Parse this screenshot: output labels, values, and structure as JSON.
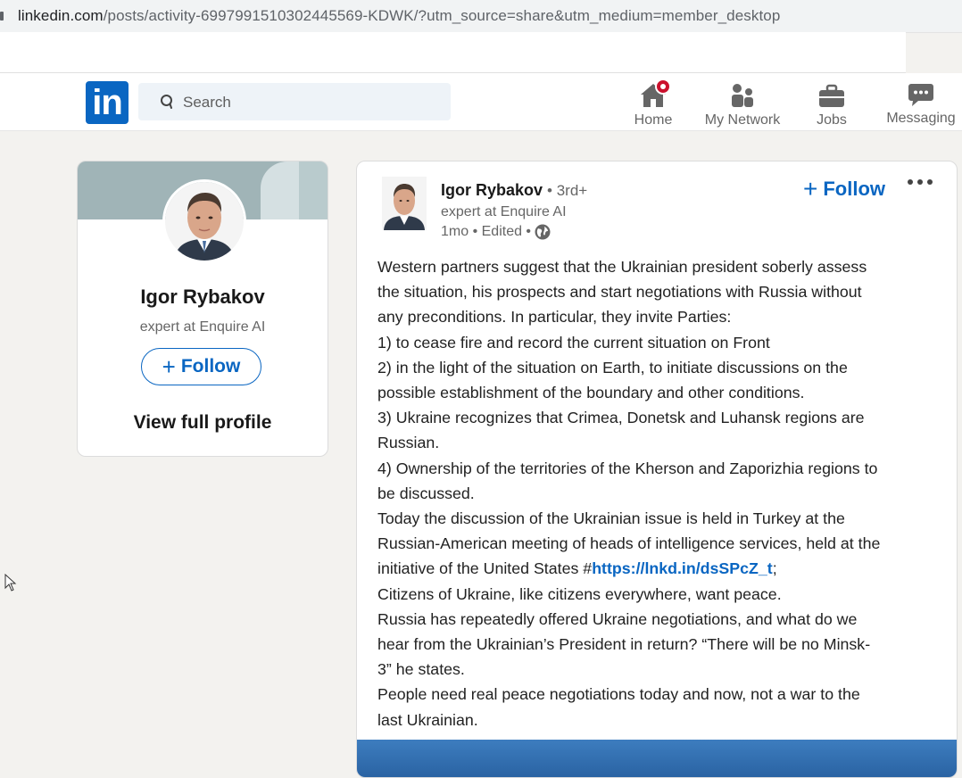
{
  "browser": {
    "url_host": "linkedin.com",
    "url_path": "/posts/activity-6997991510302445569-KDWK/?utm_source=share&utm_medium=member_desktop"
  },
  "header": {
    "logo_text": "in",
    "search_placeholder": "Search",
    "nav": [
      {
        "label": "Home",
        "icon": "home-icon",
        "badge": true
      },
      {
        "label": "My Network",
        "icon": "network-icon"
      },
      {
        "label": "Jobs",
        "icon": "briefcase-icon"
      },
      {
        "label": "Messaging",
        "icon": "chat-icon"
      }
    ],
    "brand_color": "#0a66c2",
    "badge_color": "#cb112d"
  },
  "profile_card": {
    "name": "Igor Rybakov",
    "headline": "expert at Enquire AI",
    "follow_label": "Follow",
    "view_profile_label": "View full profile"
  },
  "post": {
    "author_name": "Igor Rybakov",
    "degree": "• 3rd+",
    "headline": "expert at Enquire AI",
    "meta": "1mo • Edited •",
    "visibility_icon": "globe-icon",
    "follow_label": "Follow",
    "more_icon": "more-icon",
    "body_lines": [
      "Western partners suggest that the Ukrainian president soberly assess",
      "the situation, his prospects and start negotiations with Russia without",
      "any preconditions. In particular, they invite Parties:",
      "1) to cease fire and record the current situation on Front",
      "2) in the light of the situation on Earth, to initiate discussions on the",
      "possible establishment of the boundary and other conditions.",
      "3) Ukraine recognizes that Crimea, Donetsk and Luhansk regions are",
      "Russian.",
      "4) Ownership of the territories of the Kherson and Zaporizhia regions to",
      "be discussed.",
      "Today the discussion of the Ukrainian issue is held in Turkey at the",
      "Russian-American meeting of heads of intelligence services, held at the"
    ],
    "link_line_prefix": "initiative of the United States #",
    "link_text": "https://lnkd.in/dsSPcZ_t",
    "link_line_suffix": ";",
    "body_lines_after": [
      "Citizens of Ukraine, like citizens everywhere, want peace.",
      "Russia has repeatedly offered Ukraine negotiations, and what do we",
      "hear from the Ukrainian’s President in return? “There will be no Minsk-",
      "3” he states.",
      "People need real peace negotiations today and now, not a war to the",
      "last Ukrainian."
    ]
  }
}
